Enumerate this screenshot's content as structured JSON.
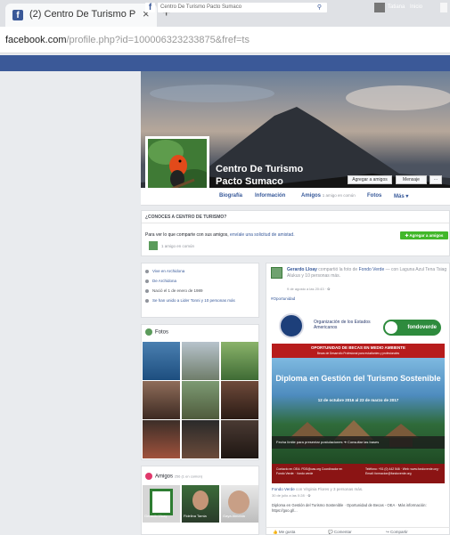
{
  "browser": {
    "tab_title": "(2) Centro De Turismo P",
    "tab_close": "×",
    "new_tab": "+",
    "url_host": "facebook.com",
    "url_path": "/profile.php?id=100006323233875&fref=ts"
  },
  "fb_top": {
    "logo": "f",
    "search_value": "Centro De Turismo Pacto Sumaco",
    "user_name": "Tatiana",
    "home": "Inicio"
  },
  "profile": {
    "name": "Centro De Turismo Pacto Sumaco",
    "add_friend_btn": "Agregar a amigos",
    "message_btn": "Mensaje",
    "more_btn": "···"
  },
  "tabs": [
    {
      "label": "Biografía",
      "sub": ""
    },
    {
      "label": "Información",
      "sub": ""
    },
    {
      "label": "Amigos",
      "sub": "1 amigo en común"
    },
    {
      "label": "Fotos",
      "sub": ""
    },
    {
      "label": "Más ▾",
      "sub": ""
    }
  ],
  "ask": {
    "title": "¿CONOCES A CENTRO DE TURISMO?",
    "text": "Para ver lo que comparte con sus amigos, ",
    "link": "envíale una solicitud de amistad.",
    "mutual": "1 amigo en común",
    "add_button": "Agregar a amigos"
  },
  "intro": [
    "Vive en Archidona",
    "De Archidona",
    "Nació el 1 de enero de 1989",
    "Se han unido a Lider Tonni y 10 personas más"
  ],
  "photos": {
    "title": "Fotos"
  },
  "friends": {
    "title": "Amigos",
    "count": "256 (1 en común)",
    "names": [
      "Gerardo Lloay",
      "Fidelina Tamia",
      "Gaya Almeida"
    ]
  },
  "post": {
    "author": "Gerardo Lloay",
    "verb": "compartió la foto de",
    "page": "Fondo Verde",
    "with": "— con Laguna Azul Tena Tsiag Alukus y 10 personas más.",
    "time": "9 de agosto a las 20:43 · ✿",
    "hashtag": "#Oportunidad",
    "oea_name": "Organización de los Estados Americanos",
    "fondo": "fondoverde",
    "opp_title": "OPORTUNIDAD DE BECAS EN MEDIO AMBIENTE",
    "opp_sub": "Becas de Desarrollo Profesional para estudiantes y profesionales",
    "diploma_title": "Diploma en Gestión del Turismo Sostenible",
    "diploma_dates": "12 de octubre 2016 al 23 de marzo de 2017",
    "strip_text": "Fecha límite para presentar postulaciones ➜ Consultar las bases",
    "contact_left": "Contacto en OEA: PDS@oas.org Coordinador en Fondo Verde: · fondo verde",
    "contact_right": "Teléfono: +51 (0) 442 546 · Web: www.fondoverde.org · Email: formacion@fondoverde.org",
    "share_author": "Fondo Verde",
    "share_with": "con Virginia Flores y 3 personas más.",
    "share_time": "30 de julio a las 0:28 · ✿",
    "share_body": "Diploma en Gestión del Turismo Sostenible · Oportunidad de Becas - OEA · Más información: https://goo.gl/...",
    "action_like": "Me gusta",
    "action_comment": "Comentar",
    "action_share": "Compartir"
  },
  "colors": {
    "fb_blue": "#3b5998",
    "link": "#365899",
    "green_button": "#42b72a"
  }
}
